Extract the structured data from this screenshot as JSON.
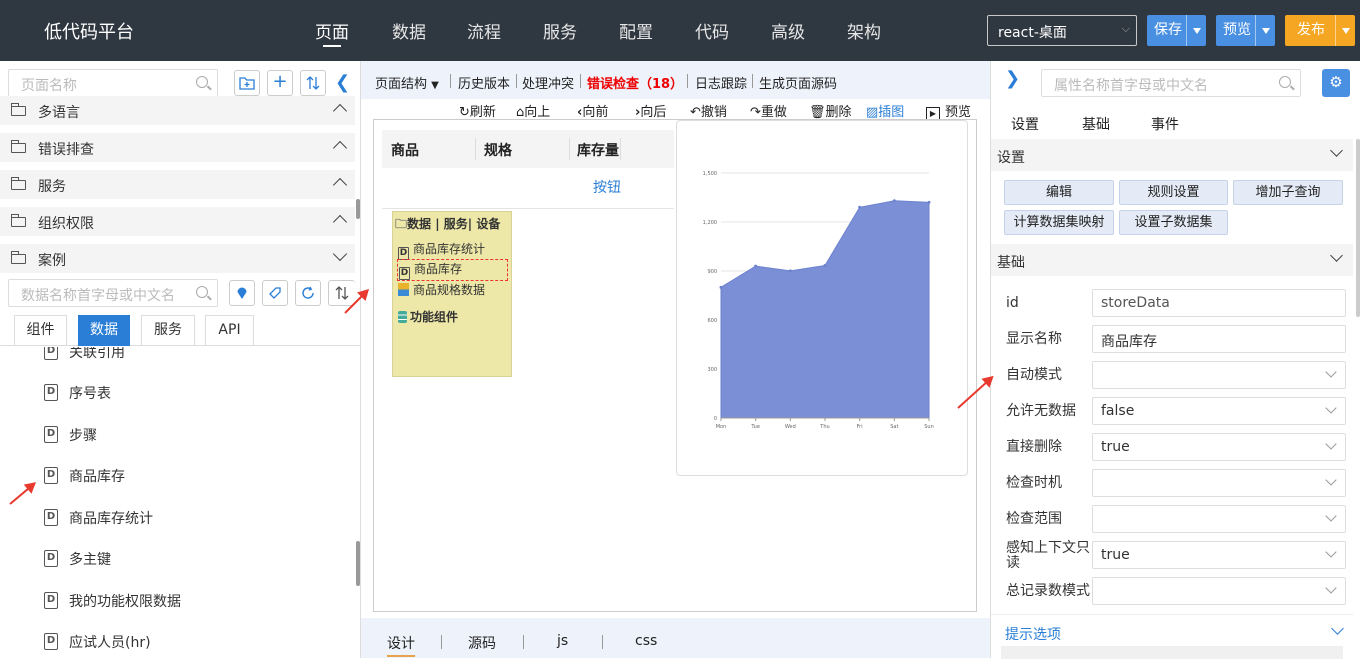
{
  "app": {
    "brand": "低代码平台",
    "nav": [
      "页面",
      "数据",
      "流程",
      "服务",
      "配置",
      "代码",
      "高级",
      "架构"
    ],
    "active_nav": "页面",
    "env_select": "react-桌面",
    "save_label": "保存",
    "preview_label": "预览",
    "publish_label": "发布",
    "colors": {
      "topbar": "#2f3740",
      "save": "#4a90e2",
      "preview": "#4a90e2",
      "publish": "#f5a623",
      "accent": "#2a7ed6"
    }
  },
  "left": {
    "page_search_placeholder": "页面名称",
    "sections": [
      {
        "label": "多语言",
        "expanded": false
      },
      {
        "label": "错误排查",
        "expanded": false
      },
      {
        "label": "服务",
        "expanded": false
      },
      {
        "label": "组织权限",
        "expanded": false
      },
      {
        "label": "案例",
        "expanded": true
      }
    ],
    "data_search_placeholder": "数据名称首字母或中文名",
    "tabs": [
      "组件",
      "数据",
      "服务",
      "API"
    ],
    "active_tab": "数据",
    "items": [
      "关联引用",
      "序号表",
      "步骤",
      "商品库存",
      "商品库存统计",
      "多主键",
      "我的功能权限数据",
      "应试人员(hr)"
    ]
  },
  "mid": {
    "toolbar1": [
      "页面结构",
      "历史版本",
      "处理冲突",
      "错误检查（18）",
      "日志跟踪",
      "生成页面源码"
    ],
    "toolbar2": [
      "刷新",
      "向上",
      "向前",
      "向后",
      "撤销",
      "重做",
      "删除",
      "插图",
      "预览"
    ],
    "grid": {
      "headers": [
        "商品",
        "规格",
        "库存量"
      ],
      "button": "按钮"
    },
    "popup": {
      "title": "数据 | 服务| 设备",
      "items": [
        "商品库存统计",
        "商品库存",
        "商品规格数据"
      ],
      "group": "功能组件"
    },
    "bottom_tabs": [
      "设计",
      "源码",
      "js",
      "css"
    ],
    "active_bottom_tab": "设计"
  },
  "chart_data": {
    "type": "area",
    "categories": [
      "Mon",
      "Tue",
      "Wed",
      "Thu",
      "Fri",
      "Sat",
      "Sun"
    ],
    "series": [
      {
        "values": [
          800,
          930,
          901,
          934,
          1290,
          1330,
          1320
        ]
      }
    ],
    "ylim": [
      0,
      1500
    ],
    "yticks": [
      "0",
      "300",
      "600",
      "900",
      "1,200",
      "1,500"
    ],
    "grid": true,
    "color": "#7b8fd6"
  },
  "right": {
    "search_placeholder": "属性名称首字母或中文名",
    "tabs": [
      "设置",
      "基础",
      "事件"
    ],
    "section_settings": "设置",
    "buttons": [
      "编辑",
      "规则设置",
      "增加子查询",
      "计算数据集映射",
      "设置子数据集"
    ],
    "section_basic": "基础",
    "props": [
      {
        "label": "id",
        "value": "storeData",
        "select": false
      },
      {
        "label": "显示名称",
        "value": "商品库存",
        "select": false
      },
      {
        "label": "自动模式",
        "value": "",
        "select": true
      },
      {
        "label": "允许无数据",
        "value": "false",
        "select": true
      },
      {
        "label": "直接删除",
        "value": "true",
        "select": true
      },
      {
        "label": "检查时机",
        "value": "",
        "select": true
      },
      {
        "label": "检查范围",
        "value": "",
        "select": true
      },
      {
        "label": "感知上下文只读",
        "value": "true",
        "select": true
      },
      {
        "label": "总记录数模式",
        "value": "",
        "select": true
      }
    ],
    "section_hint": "提示选项"
  }
}
